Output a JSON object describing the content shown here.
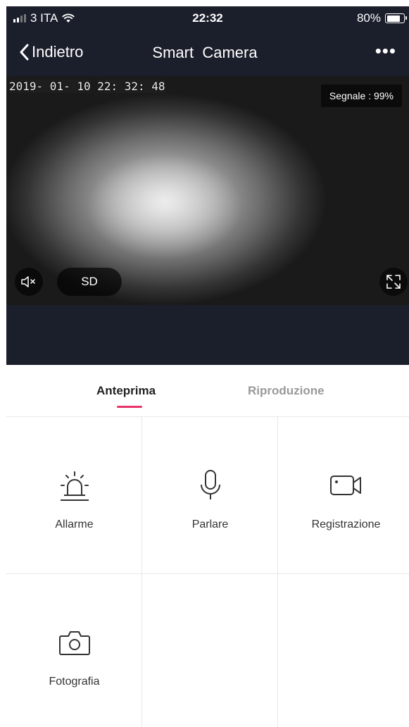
{
  "status": {
    "carrier": "3 ITA",
    "time": "22:32",
    "battery": "80%",
    "battery_level": 0.8
  },
  "nav": {
    "back_label": "Indietro",
    "title": "Smart  Camera",
    "more_label": "•••"
  },
  "camera": {
    "date": "2019- 01- 10",
    "clock": "22: 32: 48",
    "signal": "Segnale : 99%",
    "quality_label": "SD"
  },
  "tabs": [
    {
      "label": "Anteprima",
      "active": true
    },
    {
      "label": "Riproduzione",
      "active": false
    }
  ],
  "actions": [
    {
      "label": "Allarme",
      "icon": "alarm-icon"
    },
    {
      "label": "Parlare",
      "icon": "microphone-icon"
    },
    {
      "label": "Registrazione",
      "icon": "video-camera-icon"
    },
    {
      "label": "Fotografia",
      "icon": "camera-icon"
    }
  ],
  "colors": {
    "header_bg": "#1b1e2b",
    "accent": "#e8336a"
  }
}
